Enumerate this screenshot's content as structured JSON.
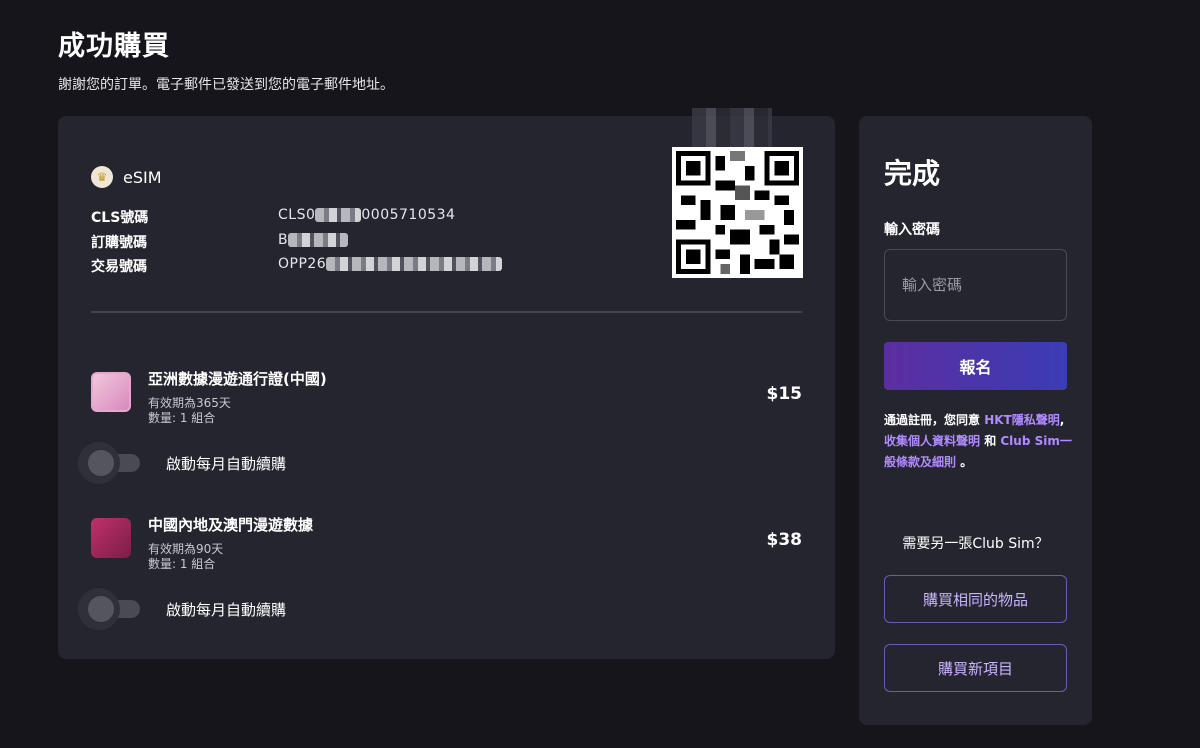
{
  "header": {
    "title": "成功購買",
    "subtitle": "謝謝您的訂單。電子郵件已發送到您的電子郵件地址。"
  },
  "order": {
    "type_label": "eSIM",
    "fields": [
      {
        "label": "CLS號碼",
        "value_start": "CLS0",
        "value_end": "0005710534"
      },
      {
        "label": "訂購號碼",
        "value_start": "B",
        "value_end": ""
      },
      {
        "label": "交易號碼",
        "value_start": "OPP26",
        "value_end": ""
      }
    ],
    "products": [
      {
        "name": "亞洲數據漫遊通行證(中國)",
        "validity": "有效期為365天",
        "quantity": "數量: 1 組合",
        "price": "$15",
        "auto_renew_label": "啟動每月自動續購",
        "auto_renew_on": false
      },
      {
        "name": "中國內地及澳門漫遊數據",
        "validity": "有效期為90天",
        "quantity": "數量: 1 組合",
        "price": "$38",
        "auto_renew_label": "啟動每月自動續購",
        "auto_renew_on": false
      }
    ]
  },
  "sidebar": {
    "title": "完成",
    "password_label": "輸入密碼",
    "password_placeholder": "輸入密碼",
    "signup_button": "報名",
    "terms": {
      "prefix": "通過註冊，您同意 ",
      "link1": "HKT隱私聲明",
      "sep1": ", ",
      "link2": "收集個人資料聲明",
      "sep2": " 和 ",
      "link3": "Club Sim一般條款及細則",
      "suffix": " 。"
    },
    "another_question": "需要另一張Club Sim？",
    "buy_same_button": "購買相同的物品",
    "buy_new_button": "購買新項目"
  },
  "colors": {
    "background": "#15151b",
    "card": "#25252f",
    "accent_start": "#5b2ea0",
    "accent_end": "#3b3cb5",
    "link": "#b08aff"
  }
}
